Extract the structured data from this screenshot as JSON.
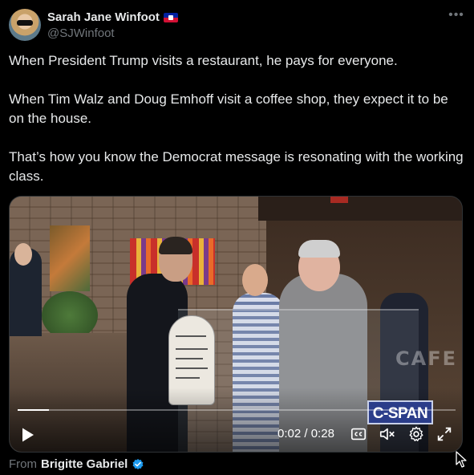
{
  "author": {
    "display_name": "Sarah Jane Winfoot",
    "handle": "@SJWinfoot",
    "flag_icon": "haiti-flag-icon"
  },
  "more_icon": "more-dots-icon",
  "tweet": {
    "paragraphs": [
      "When President Trump visits a restaurant, he pays for everyone.",
      "When Tim Walz and Doug Emhoff visit a coffee shop, they expect it to be on the house.",
      "That’s how you know the Democrat message is resonating with the working class."
    ]
  },
  "video": {
    "watermark": "C-SPAN",
    "cafe_sign": "CAFE",
    "time_current": "0:02",
    "time_separator": "/",
    "time_total": "0:28",
    "progress_fraction": 0.0714
  },
  "attribution": {
    "prefix": "From",
    "name": "Brigitte Gabriel"
  },
  "colors": {
    "background": "#000000",
    "text_primary": "#e7e9ea",
    "text_secondary": "#71767b",
    "verified_blue": "#1d9bf0",
    "cspan_blue": "#2b3d8a"
  }
}
